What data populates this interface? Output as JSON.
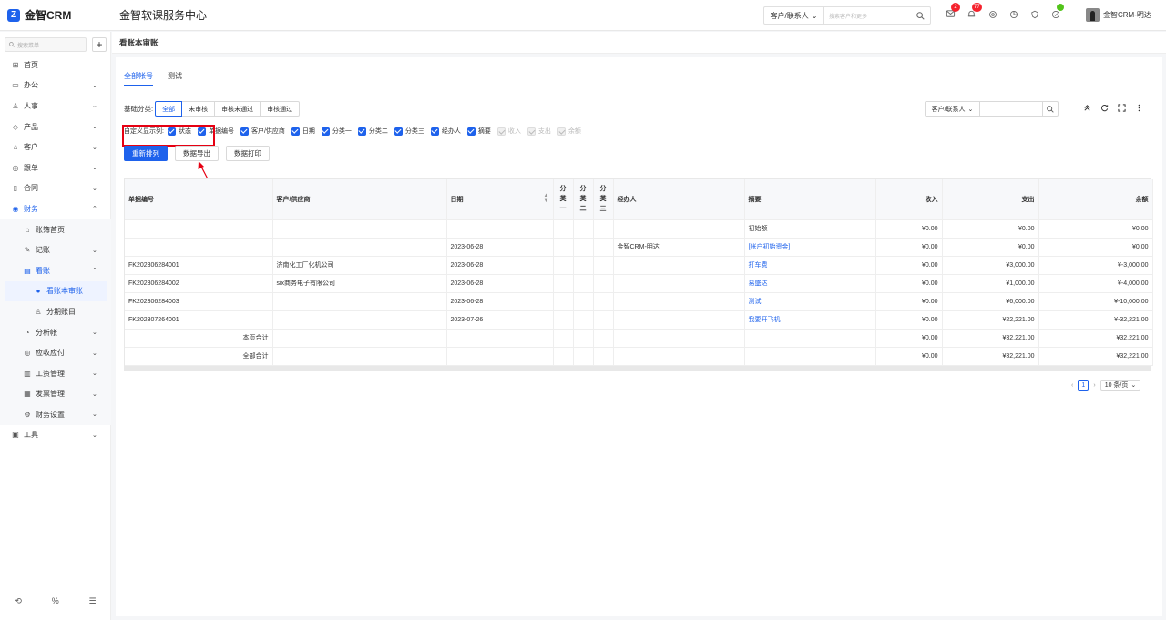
{
  "app": {
    "name": "金智CRM",
    "title": "金智软课服务中心"
  },
  "top_search": {
    "select": "客户/联系人",
    "placeholder": "搜索客户和更多"
  },
  "top_badges": {
    "messages": "2",
    "notifications": "77"
  },
  "user": {
    "name": "金智CRM-明达"
  },
  "sidebar": {
    "search_placeholder": "搜索菜单",
    "items": [
      {
        "label": "首页",
        "icon": "home-icon"
      },
      {
        "label": "办公",
        "icon": "office-icon"
      },
      {
        "label": "人事",
        "icon": "person-icon"
      },
      {
        "label": "产品",
        "icon": "product-icon"
      },
      {
        "label": "客户",
        "icon": "customer-icon"
      },
      {
        "label": "跟单",
        "icon": "follow-icon"
      },
      {
        "label": "合同",
        "icon": "contract-icon"
      },
      {
        "label": "财务",
        "icon": "finance-icon"
      },
      {
        "label": "账簿首页",
        "icon": "book-home-icon"
      },
      {
        "label": "记账",
        "icon": "record-icon"
      },
      {
        "label": "看账",
        "icon": "view-account-icon"
      },
      {
        "label": "看账本审账",
        "icon": "user-icon"
      },
      {
        "label": "分期账目",
        "icon": "installment-icon"
      },
      {
        "label": "分析帐",
        "icon": "analysis-icon"
      },
      {
        "label": "应收应付",
        "icon": "receivable-icon"
      },
      {
        "label": "工资管理",
        "icon": "salary-icon"
      },
      {
        "label": "发票管理",
        "icon": "invoice-icon"
      },
      {
        "label": "财务设置",
        "icon": "finance-settings-icon"
      },
      {
        "label": "工具",
        "icon": "tool-icon"
      }
    ],
    "bottom_icons": [
      "history-icon",
      "percent-icon",
      "settings-list-icon"
    ]
  },
  "page": {
    "title": "看账本审账"
  },
  "tabs": [
    "全部帐号",
    "测试"
  ],
  "filter": {
    "label": "基础分类:",
    "options": [
      "全部",
      "未审核",
      "审核未通过",
      "审核通过"
    ],
    "selected": "全部"
  },
  "right_search": {
    "select": "客户/联系人"
  },
  "columns_config": {
    "label": "自定义显示列:",
    "items": [
      {
        "label": "状态",
        "checked": true,
        "disabled": false
      },
      {
        "label": "单据编号",
        "checked": true,
        "disabled": false
      },
      {
        "label": "客户/供应商",
        "checked": true,
        "disabled": false
      },
      {
        "label": "日期",
        "checked": true,
        "disabled": false
      },
      {
        "label": "分类一",
        "checked": true,
        "disabled": false
      },
      {
        "label": "分类二",
        "checked": true,
        "disabled": false
      },
      {
        "label": "分类三",
        "checked": true,
        "disabled": false
      },
      {
        "label": "经办人",
        "checked": true,
        "disabled": false
      },
      {
        "label": "摘要",
        "checked": true,
        "disabled": false
      },
      {
        "label": "收入",
        "checked": true,
        "disabled": true
      },
      {
        "label": "支出",
        "checked": true,
        "disabled": true
      },
      {
        "label": "余额",
        "checked": true,
        "disabled": true
      }
    ]
  },
  "buttons": {
    "reorder": "重新排列",
    "export": "数据导出",
    "print": "数据打印"
  },
  "table": {
    "headers": [
      "单据编号",
      "客户/供应商",
      "日期",
      "分类一",
      "分类二",
      "分类三",
      "经办人",
      "摘要",
      "收入",
      "支出",
      "余额"
    ],
    "rows": [
      {
        "no": "",
        "party": "",
        "date": "",
        "c1": "",
        "c2": "",
        "c3": "",
        "handler": "",
        "summary": "初始额",
        "summary_link": false,
        "income": "¥0.00",
        "expense": "¥0.00",
        "balance": "¥0.00"
      },
      {
        "no": "",
        "party": "",
        "date": "2023-06-28",
        "c1": "",
        "c2": "",
        "c3": "",
        "handler": "金智CRM-明达",
        "summary": "[帐户初始资金]",
        "summary_link": true,
        "income": "¥0.00",
        "expense": "¥0.00",
        "balance": "¥0.00"
      },
      {
        "no": "FK202306284001",
        "party": "济南化工厂化机公司",
        "date": "2023-06-28",
        "c1": "",
        "c2": "",
        "c3": "",
        "handler": "",
        "summary": "打车费",
        "summary_link": true,
        "income": "¥0.00",
        "expense": "¥3,000.00",
        "balance": "¥-3,000.00"
      },
      {
        "no": "FK202306284002",
        "party": "six商务电子有限公司",
        "date": "2023-06-28",
        "c1": "",
        "c2": "",
        "c3": "",
        "handler": "",
        "summary": "易盛达",
        "summary_link": true,
        "income": "¥0.00",
        "expense": "¥1,000.00",
        "balance": "¥-4,000.00"
      },
      {
        "no": "FK202306284003",
        "party": "",
        "date": "2023-06-28",
        "c1": "",
        "c2": "",
        "c3": "",
        "handler": "",
        "summary": "测试",
        "summary_link": true,
        "income": "¥0.00",
        "expense": "¥6,000.00",
        "balance": "¥-10,000.00"
      },
      {
        "no": "FK202307264001",
        "party": "",
        "date": "2023-07-26",
        "c1": "",
        "c2": "",
        "c3": "",
        "handler": "",
        "summary": "我要开飞机",
        "summary_link": true,
        "income": "¥0.00",
        "expense": "¥22,221.00",
        "balance": "¥-32,221.00"
      }
    ],
    "totals": [
      {
        "label": "本页合计",
        "income": "¥0.00",
        "expense": "¥32,221.00",
        "balance": "¥32,221.00"
      },
      {
        "label": "全部合计",
        "income": "¥0.00",
        "expense": "¥32,221.00",
        "balance": "¥32,221.00"
      }
    ]
  },
  "pagination": {
    "current": "1",
    "page_size": "10 条/页"
  },
  "colors": {
    "accent": "#1e62ec",
    "annotation": "#e60012"
  }
}
